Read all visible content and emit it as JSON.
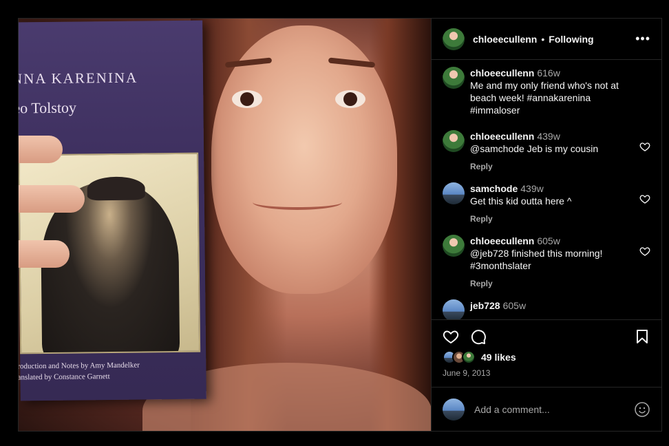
{
  "post": {
    "book_title": "NNA KARENINA",
    "book_author": "eo Tolstoy",
    "book_credits_line1": "roduction and Notes by Amy Mandelker",
    "book_credits_line2": "anslated by Constance Garnett"
  },
  "header": {
    "username": "chloeecullenn",
    "separator": "•",
    "follow_status": "Following",
    "more_icon": "more-horizontal-icon"
  },
  "comments": [
    {
      "username": "chloeecullenn",
      "time": "616w",
      "text": "Me and my only friend who's not at beach week! #annakarenina #immaloser",
      "avatar": "green"
    },
    {
      "username": "chloeecullenn",
      "time": "439w",
      "text": "@samchode Jeb is my cousin",
      "reply": "Reply",
      "avatar": "green"
    },
    {
      "username": "samchode",
      "time": "439w",
      "text": "Get this kid outta here ^",
      "reply": "Reply",
      "avatar": "sky"
    },
    {
      "username": "chloeecullenn",
      "time": "605w",
      "text": "@jeb728 finished this morning! #3monthslater",
      "reply": "Reply",
      "avatar": "green"
    },
    {
      "username": "jeb728",
      "time": "605w",
      "avatar": "sky"
    }
  ],
  "actions": {
    "like_icon": "heart-icon",
    "comment_icon": "comment-icon",
    "save_icon": "bookmark-icon"
  },
  "likes_text": "49 likes",
  "date": "June 9, 2013",
  "add_comment": {
    "placeholder": "Add a comment...",
    "emoji_icon": "smiley-icon"
  },
  "colors": {
    "background": "#000000",
    "text": "#f5f5f5",
    "secondary_text": "#a8a8a8",
    "divider": "#262626"
  }
}
